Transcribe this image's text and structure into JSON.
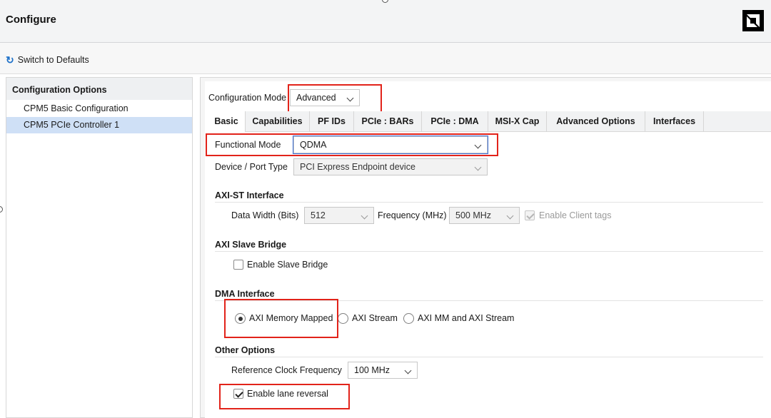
{
  "window": {
    "title": "Configure"
  },
  "toolbar": {
    "switch_defaults": "Switch to Defaults"
  },
  "tree": {
    "title": "Configuration Options",
    "items": [
      {
        "label": "CPM5 Basic Configuration",
        "selected": false
      },
      {
        "label": "CPM5 PCIe Controller 1",
        "selected": true
      }
    ]
  },
  "config_mode": {
    "label": "Configuration Mode",
    "value": "Advanced"
  },
  "tabs": [
    {
      "label": "Basic",
      "active": true
    },
    {
      "label": "Capabilities",
      "active": false
    },
    {
      "label": "PF IDs",
      "active": false
    },
    {
      "label": "PCIe : BARs",
      "active": false
    },
    {
      "label": "PCIe : DMA",
      "active": false
    },
    {
      "label": "MSI-X Cap",
      "active": false
    },
    {
      "label": "Advanced Options",
      "active": false
    },
    {
      "label": "Interfaces",
      "active": false
    }
  ],
  "basic": {
    "functional_mode": {
      "label": "Functional Mode",
      "value": "QDMA"
    },
    "device_port_type": {
      "label": "Device / Port Type",
      "value": "PCI Express Endpoint device"
    },
    "axi_st": {
      "title": "AXI-ST Interface",
      "data_width_label": "Data Width (Bits)",
      "data_width_value": "512",
      "frequency_label": "Frequency (MHz)",
      "frequency_value": "500 MHz",
      "client_tags_label": "Enable Client tags",
      "client_tags_checked": true
    },
    "axi_slave_bridge": {
      "title": "AXI Slave Bridge",
      "enable_label": "Enable Slave Bridge",
      "enable_checked": false
    },
    "dma_interface": {
      "title": "DMA Interface",
      "options": [
        "AXI Memory Mapped",
        "AXI Stream",
        "AXI MM and AXI Stream"
      ],
      "selected": "AXI Memory Mapped"
    },
    "other_options": {
      "title": "Other Options",
      "ref_clock_label": "Reference Clock Frequency",
      "ref_clock_value": "100 MHz",
      "lane_reversal_label": "Enable lane reversal",
      "lane_reversal_checked": true
    }
  },
  "colors": {
    "highlight_red": "#e2231a",
    "focus_blue": "#3b6fd8",
    "selection_blue": "#cfe0f6",
    "refresh_icon": "#1b6fc8"
  }
}
